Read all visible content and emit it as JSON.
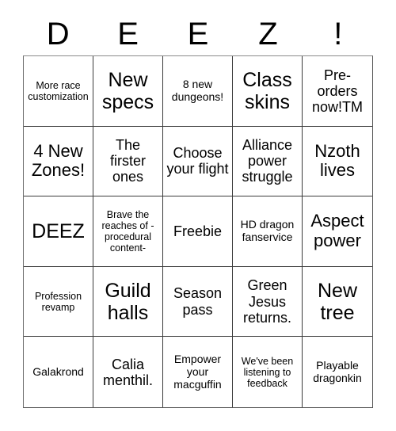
{
  "card": {
    "title_letters": [
      "D",
      "E",
      "E",
      "Z",
      "!"
    ],
    "grid_size": 5,
    "rows": [
      [
        {
          "text": "More race customization",
          "size": "xs"
        },
        {
          "text": "New specs",
          "size": "xl"
        },
        {
          "text": "8 new dungeons!",
          "size": "sm"
        },
        {
          "text": "Class skins",
          "size": "xl"
        },
        {
          "text": "Pre-orders now!TM",
          "size": "md"
        }
      ],
      [
        {
          "text": "4 New Zones!",
          "size": "lg"
        },
        {
          "text": "The firster ones",
          "size": "md"
        },
        {
          "text": "Choose your flight",
          "size": "md"
        },
        {
          "text": "Alliance power struggle",
          "size": "md"
        },
        {
          "text": "Nzoth lives",
          "size": "lg"
        }
      ],
      [
        {
          "text": "DEEZ",
          "size": "xl"
        },
        {
          "text": "Brave the reaches of - procedural content-",
          "size": "xs"
        },
        {
          "text": "Freebie",
          "size": "md"
        },
        {
          "text": "HD dragon fanservice",
          "size": "sm"
        },
        {
          "text": "Aspect power",
          "size": "lg"
        }
      ],
      [
        {
          "text": "Profession revamp",
          "size": "xs"
        },
        {
          "text": "Guild halls",
          "size": "xl"
        },
        {
          "text": "Season pass",
          "size": "md"
        },
        {
          "text": "Green Jesus returns.",
          "size": "md"
        },
        {
          "text": "New tree",
          "size": "xl"
        }
      ],
      [
        {
          "text": "Galakrond",
          "size": "sm"
        },
        {
          "text": "Calia menthil.",
          "size": "md"
        },
        {
          "text": "Empower your macguffin",
          "size": "sm"
        },
        {
          "text": "We've been listening to feedback",
          "size": "xs"
        },
        {
          "text": "Playable dragonkin",
          "size": "sm"
        }
      ]
    ]
  },
  "colors": {
    "background": "#ffffff",
    "text": "#000000",
    "grid_line": "#3b3b3b",
    "grid_border": "#6e6e6e"
  }
}
